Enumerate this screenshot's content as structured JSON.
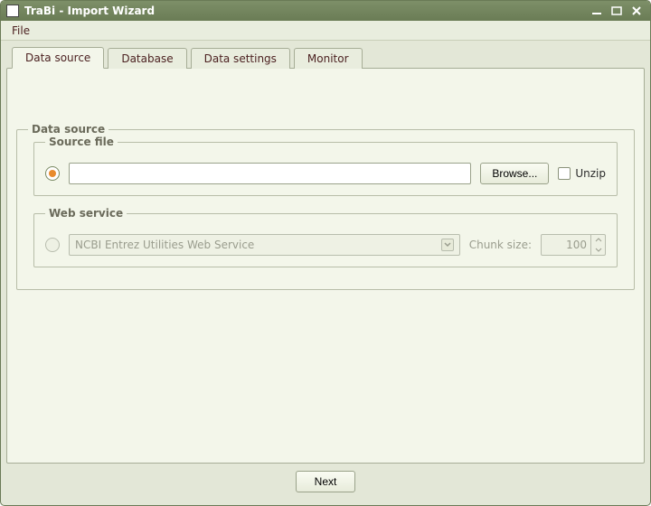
{
  "window": {
    "title": "TraBi - Import Wizard"
  },
  "menu": {
    "file": "File"
  },
  "tabs": [
    "Data source",
    "Database",
    "Data settings",
    "Monitor"
  ],
  "active_tab": 0,
  "datasource": {
    "legend": "Data source",
    "sourcefile": {
      "legend": "Source file",
      "path": "",
      "browse": "Browse...",
      "unzip": "Unzip",
      "unzip_checked": false,
      "selected": true
    },
    "webservice": {
      "legend": "Web service",
      "selected": false,
      "combo_value": "NCBI Entrez Utilities Web Service",
      "chunk_label": "Chunk size:",
      "chunk_value": "100"
    }
  },
  "footer": {
    "next": "Next"
  }
}
